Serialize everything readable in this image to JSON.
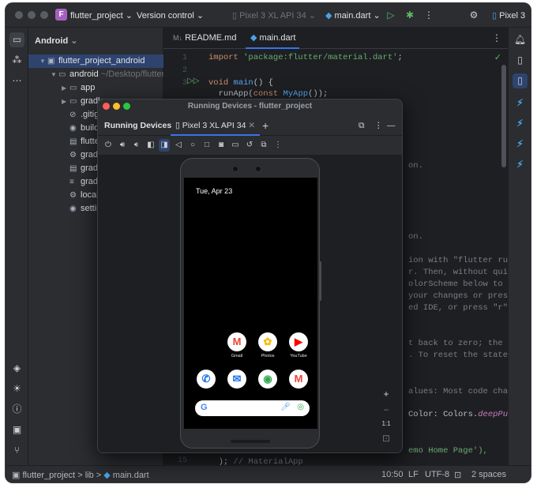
{
  "titlebar": {
    "project_badge": "F",
    "project_name": "flutter_project",
    "version_control": "Version control",
    "device_selector": "Pixel 3 XL API 34",
    "run_config": "main.dart",
    "right_device": "Pixel 3"
  },
  "project_panel": {
    "header": "Android",
    "items": [
      {
        "label": "flutter_project_android",
        "extra": ""
      },
      {
        "label": "android",
        "extra": "~/Desktop/flutter_p"
      },
      {
        "label": "app"
      },
      {
        "label": "gradle"
      },
      {
        "label": ".gitign"
      },
      {
        "label": "build.g"
      },
      {
        "label": "flutter"
      },
      {
        "label": "gradle"
      },
      {
        "label": "gradle"
      },
      {
        "label": "gradle"
      },
      {
        "label": "local.p"
      },
      {
        "label": "settin"
      }
    ]
  },
  "editor": {
    "tabs": [
      {
        "label": "README.md"
      },
      {
        "label": "main.dart"
      }
    ],
    "line_numbers": {
      "first": "1",
      "second": "2",
      "third": "3",
      "last": "15"
    },
    "lines": {
      "l1_kw": "import",
      "l1_str": "'package:flutter/material.dart'",
      "l1_end": ";",
      "l3_kw": "void",
      "l3_fn": "main",
      "l3_end": "() {",
      "l4_a": "  runApp(",
      "l4_kw": "const",
      "l4_fn": "MyApp",
      "l4_end": "());",
      "frag1": "on.",
      "frag2": "on.",
      "frag3": "ion with \"flutter run\". Y",
      "frag4": "r. Then, without quitting",
      "frag5": "olorScheme below to Color",
      "frag6": "your changes or press the",
      "frag7": "ed IDE, or press \"r\" if y",
      "frag8": "t back to zero; the appli",
      "frag9": ". To reset the state, use",
      "frag10": "alues: Most code changes",
      "frag11a": "Color: Colors.",
      "frag11b": "deepPurple",
      "frag11c": ")",
      "frag12": "emo Home Page'),",
      "frag13a": "  ); ",
      "frag13b": "// MaterialApp"
    }
  },
  "running_devices": {
    "window_title": "Running Devices - flutter_project",
    "tab_label": "Running Devices",
    "device_tab": "Pixel 3 XL API 34",
    "zoom_ratio": "1:1",
    "phone": {
      "date": "Tue, Apr 23",
      "apps_row1": [
        {
          "name": "Gmail",
          "glyph": "M",
          "color": "#ea4335"
        },
        {
          "name": "Photos",
          "glyph": "✿",
          "color": "#fbbc05"
        },
        {
          "name": "YouTube",
          "glyph": "▶",
          "color": "#ff0000"
        }
      ],
      "dock": [
        {
          "glyph": "✆",
          "color": "#1a73e8"
        },
        {
          "glyph": "✉",
          "color": "#1a73e8"
        },
        {
          "glyph": "◉",
          "color": "#34a853"
        },
        {
          "glyph": "M",
          "color": "#ea4335"
        }
      ],
      "search_glyph": "G"
    }
  },
  "statusbar": {
    "breadcrumb_project": "flutter_project",
    "breadcrumb_sep": ">",
    "breadcrumb_lib": "lib",
    "breadcrumb_file": "main.dart",
    "position": "10:50",
    "line_sep": "LF",
    "encoding": "UTF-8",
    "indent": "2 spaces"
  }
}
